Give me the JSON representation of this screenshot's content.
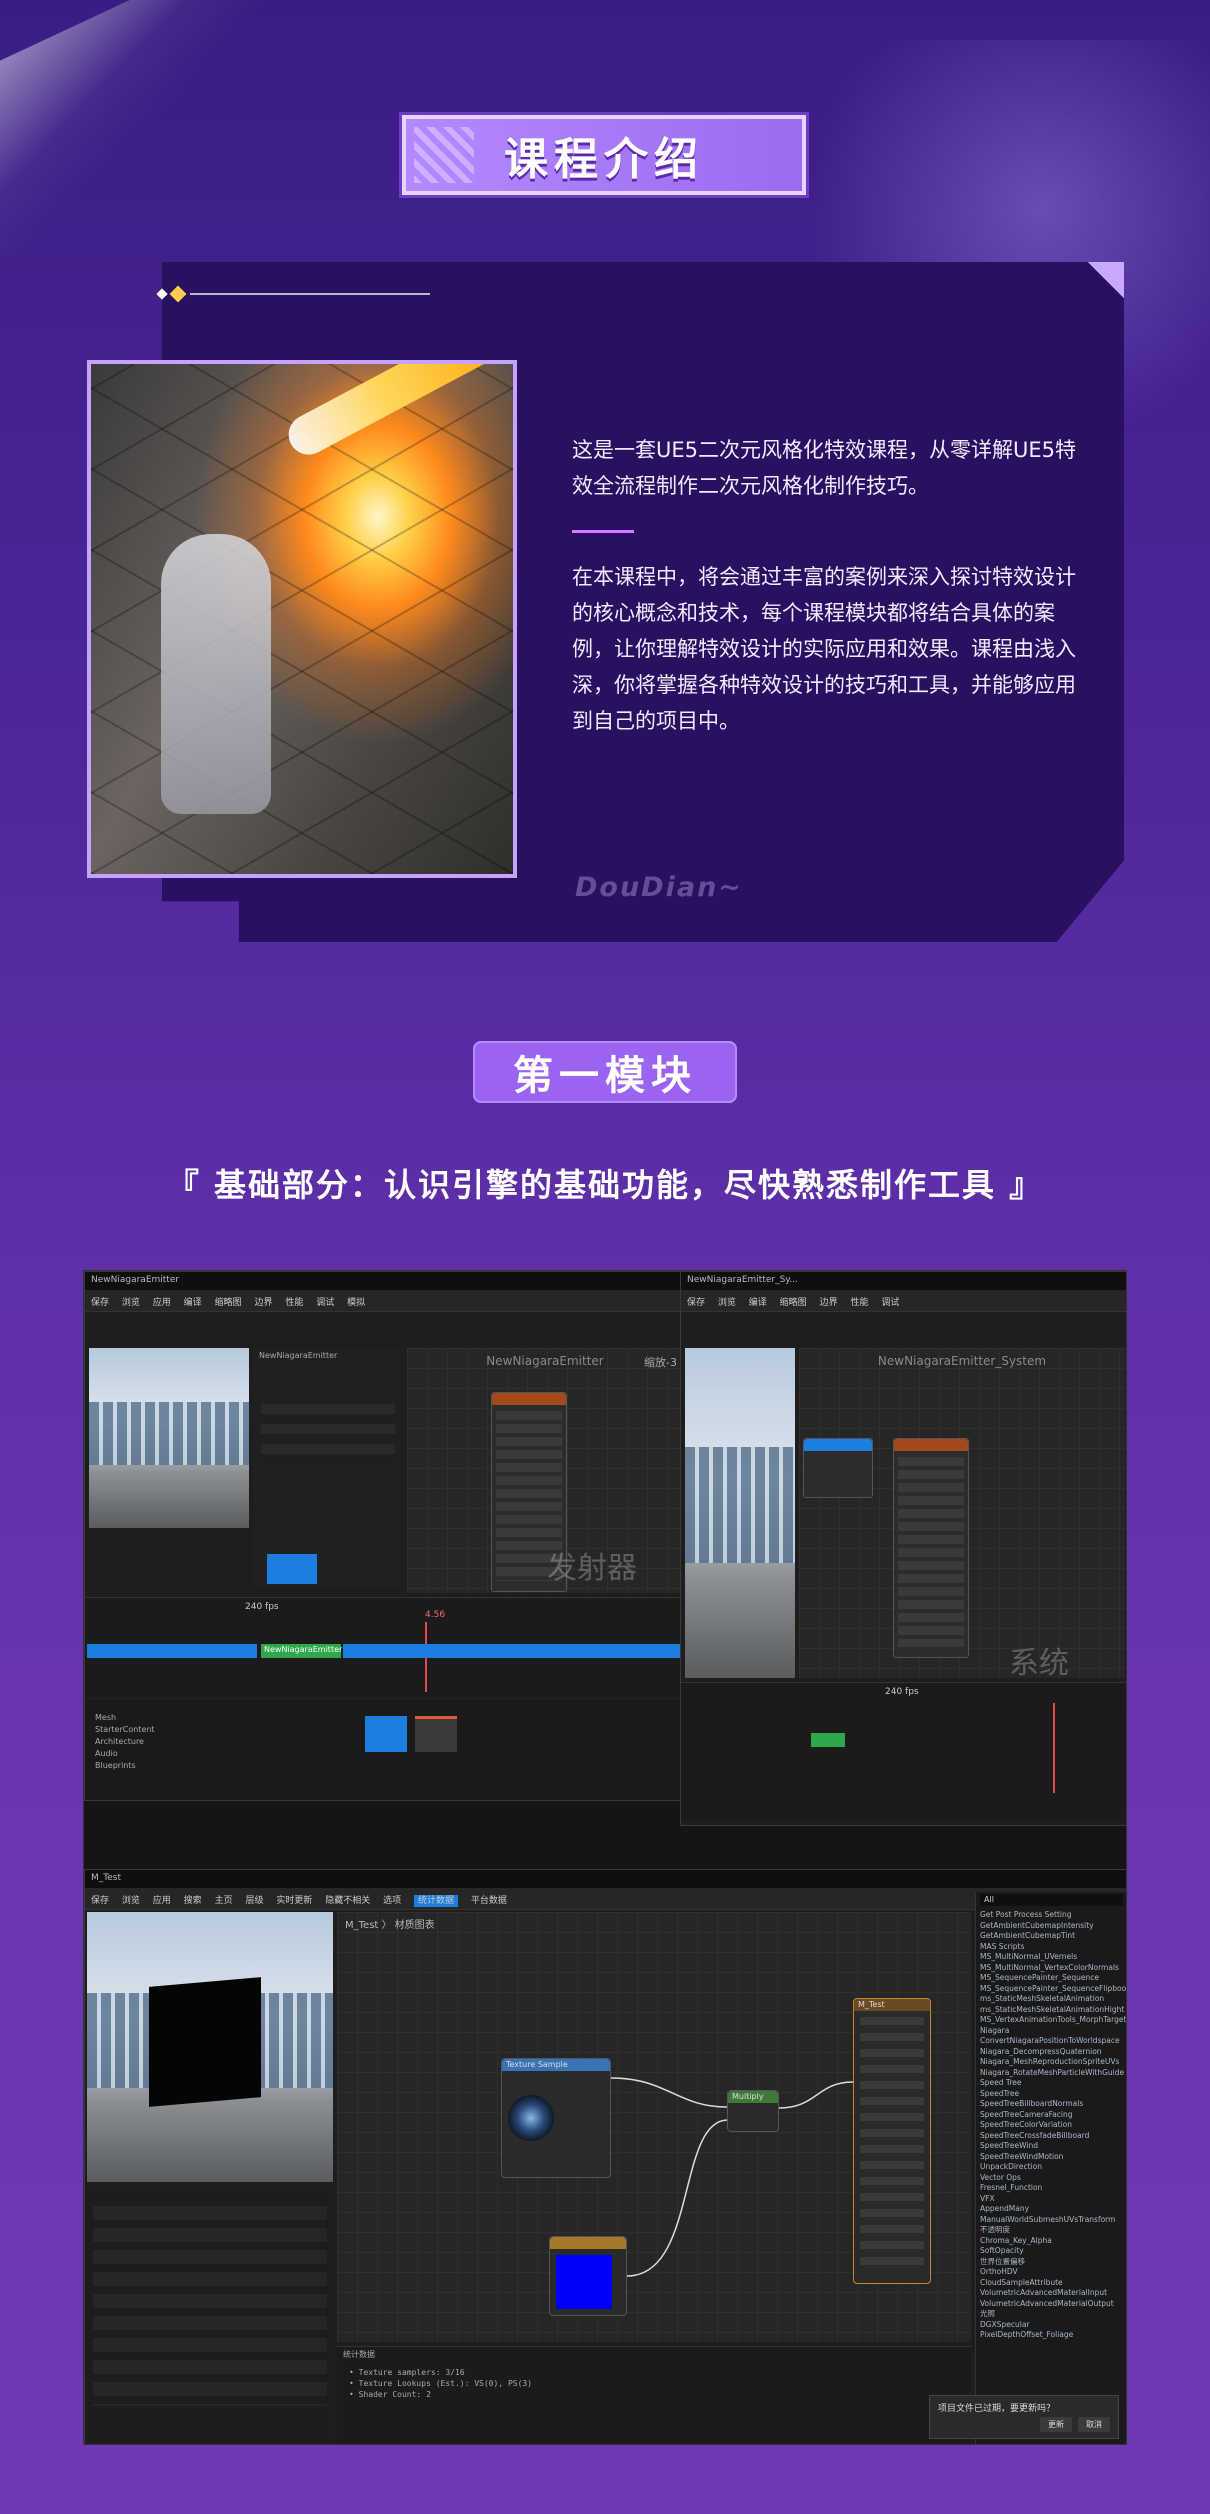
{
  "intro": {
    "tag": "课程介绍",
    "paragraph1": "这是一套UE5二次元风格化特效课程，从零详解UE5特效全流程制作二次元风格化制作技巧。",
    "paragraph2": "在本课程中，将会通过丰富的案例来深入探讨特效设计的核心概念和技术，每个课程模块都将结合具体的案例，让你理解特效设计的实际应用和效果。课程由浅入深，你将掌握各种特效设计的技巧和工具，并能够应用到自己的项目中。",
    "watermark": "DouDian~"
  },
  "module": {
    "tag": "第一模块",
    "subtitle": "『 基础部分：认识引擎的基础功能，尽快熟悉制作工具 』"
  },
  "editor": {
    "left_window_title": "NewNiagaraEmitter",
    "left_graph_title": "NewNiagaraEmitter",
    "left_big_label": "发射器",
    "left_zoom": "缩放-3",
    "right_window_title": "NewNiagaraEmitter_Sy...",
    "right_graph_title": "NewNiagaraEmitter_System",
    "right_big_label": "系统",
    "timeline_fps": "240 fps",
    "timeline_time": "4.56",
    "track_name": "NewNiagaraEmitter",
    "toolbar_left": [
      "保存",
      "浏览",
      "应用",
      "编译",
      "缩略图",
      "边界",
      "性能",
      "调试",
      "模拟"
    ],
    "toolbar_right": [
      "保存",
      "浏览",
      "编译",
      "缩略图",
      "边界",
      "性能",
      "调试"
    ],
    "content_folders": [
      "Mesh",
      "StarterContent",
      "Architecture",
      "Audio",
      "Blueprints"
    ],
    "material_tab": "M_Test",
    "material_breadcrumb": "M_Test 〉 材质图表",
    "material_toolbar": [
      "保存",
      "浏览",
      "应用",
      "搜索",
      "主页",
      "层级",
      "实时更新",
      "隐藏不相关",
      "选项",
      "统计数据",
      "平台数据"
    ],
    "node_texture_sample": "Texture Sample",
    "node_multiply": "Multiply",
    "node_result": "M_Test",
    "stats_label": "统计数据",
    "stats_lines": [
      "• Texture samplers: 3/16",
      "• Texture Lookups (Est.): VS(0), PS(3)",
      "• Shader Count: 2"
    ],
    "palette_items": [
      "Get Post Process Setting",
      "GetAmbientCubemapIntensity",
      "GetAmbientCubemapTint",
      "MAS Scripts",
      "MS_MultiNormal_UVernels",
      "MS_MultiNormal_VertexColorNormals",
      "MS_SequencePainter_Sequence",
      "MS_SequencePainter_SequenceFlipbook",
      "ms_StaticMeshSkeletalAnimation",
      "ms_StaticMeshSkeletalAnimationHight",
      "MS_VertexAnimationTools_MorphTarget",
      "Niagara",
      "ConvertNiagaraPositionToWorldspace",
      "Niagara_DecompressQuaternion",
      "Niagara_MeshReproductionSpriteUVs",
      "Niagara_RotateMeshParticleWithGuide",
      "Speed Tree",
      "SpeedTree",
      "SpeedTreeBillboardNormals",
      "SpeedTreeCameraFacing",
      "SpeedTreeColorVariation",
      "SpeedTreeCrossfadeBillboard",
      "SpeedTreeWind",
      "SpeedTreeWindMotion",
      "UnpackDirection",
      "Vector Ops",
      "Fresnel_Function",
      "VFX",
      "AppendMany",
      "ManualWorldSubmeshUVsTransform",
      "不透明度",
      "Chroma_Key_Alpha",
      "SoftOpacity",
      "世界位置偏移",
      "OrthoHDV",
      "CloudSampleAttribute",
      "VolumetricAdvancedMaterialInput",
      "VolumetricAdvancedMaterialOutput",
      "光照",
      "DGXSpecular",
      "PixelDepthOffset_Foliage"
    ],
    "palette_search": "All",
    "notify_text": "项目文件已过期，要更新吗？",
    "notify_update": "更新",
    "notify_dismiss": "取消"
  },
  "colors": {
    "accent": "#9a64f0",
    "tag_border": "#e6d4ff",
    "text_light": "#f2eaff"
  }
}
